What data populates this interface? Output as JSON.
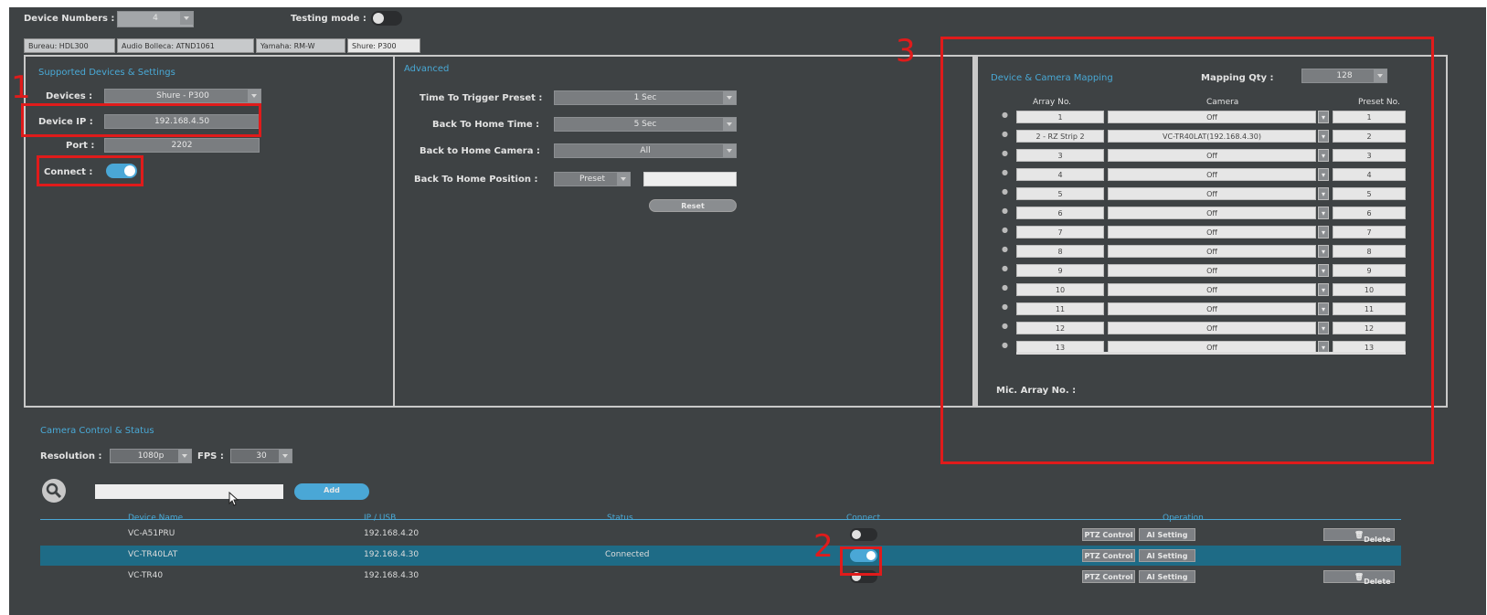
{
  "top": {
    "device_numbers_label": "Device Numbers :",
    "device_numbers_value": "4",
    "testing_mode_label": "Testing mode :"
  },
  "tabs": [
    "Bureau: HDL300",
    "Audio Bolleca: ATND1061",
    "Yamaha: RM-W",
    "Shure: P300"
  ],
  "supported": {
    "title": "Supported Devices & Settings",
    "devices_label": "Devices :",
    "devices_value": "Shure - P300",
    "device_ip_label": "Device IP :",
    "device_ip_value": "192.168.4.50",
    "port_label": "Port :",
    "port_value": "2202",
    "connect_label": "Connect :"
  },
  "advanced": {
    "title": "Advanced",
    "trigger_label": "Time To Trigger Preset :",
    "trigger_value": "1 Sec",
    "back_home_time_label": "Back To Home Time :",
    "back_home_time_value": "5 Sec",
    "back_home_camera_label": "Back to Home Camera :",
    "back_home_camera_value": "All",
    "back_home_position_label": "Back To Home Position :",
    "back_home_position_value": "Preset",
    "reset_label": "Reset"
  },
  "mapping": {
    "title": "Device & Camera Mapping",
    "mapping_qty_label": "Mapping Qty :",
    "mapping_qty_value": "128",
    "col_array": "Array No.",
    "col_camera": "Camera",
    "col_preset": "Preset No.",
    "rows": [
      {
        "array": "1",
        "camera": "Off",
        "preset": "1"
      },
      {
        "array": "2 - RZ  Strip 2",
        "camera": "VC-TR40LAT(192.168.4.30)",
        "preset": "2"
      },
      {
        "array": "3",
        "camera": "Off",
        "preset": "3"
      },
      {
        "array": "4",
        "camera": "Off",
        "preset": "4"
      },
      {
        "array": "5",
        "camera": "Off",
        "preset": "5"
      },
      {
        "array": "6",
        "camera": "Off",
        "preset": "6"
      },
      {
        "array": "7",
        "camera": "Off",
        "preset": "7"
      },
      {
        "array": "8",
        "camera": "Off",
        "preset": "8"
      },
      {
        "array": "9",
        "camera": "Off",
        "preset": "9"
      },
      {
        "array": "10",
        "camera": "Off",
        "preset": "10"
      },
      {
        "array": "11",
        "camera": "Off",
        "preset": "11"
      },
      {
        "array": "12",
        "camera": "Off",
        "preset": "12"
      },
      {
        "array": "13",
        "camera": "Off",
        "preset": "13"
      }
    ],
    "mic_array_label": "Mic. Array No. :"
  },
  "camera_control": {
    "title": "Camera Control & Status",
    "resolution_label": "Resolution :",
    "resolution_value": "1080p",
    "fps_label": "FPS :",
    "fps_value": "30",
    "search_placeholder": "",
    "add_label": "Add",
    "headers": [
      "Device Name",
      "IP / USB",
      "Status",
      "Connect",
      "Operation"
    ],
    "ptz_label": "PTZ Control",
    "ai_label": "AI Setting",
    "delete_label": "Delete",
    "devices": [
      {
        "name": "VC-A51PRU",
        "ip": "192.168.4.20",
        "status": "",
        "connected": false,
        "show_delete": true
      },
      {
        "name": "VC-TR40LAT",
        "ip": "192.168.4.30",
        "status": "Connected",
        "connected": true,
        "show_delete": false
      },
      {
        "name": "VC-TR40",
        "ip": "192.168.4.30",
        "status": "",
        "connected": false,
        "show_delete": true
      }
    ]
  },
  "annotations": [
    "1",
    "2",
    "3"
  ],
  "colors": {
    "background": "#3e4244",
    "accent": "#4aa7d6",
    "selected_row": "#1e6b86",
    "highlight_box": "#e01b1b"
  }
}
